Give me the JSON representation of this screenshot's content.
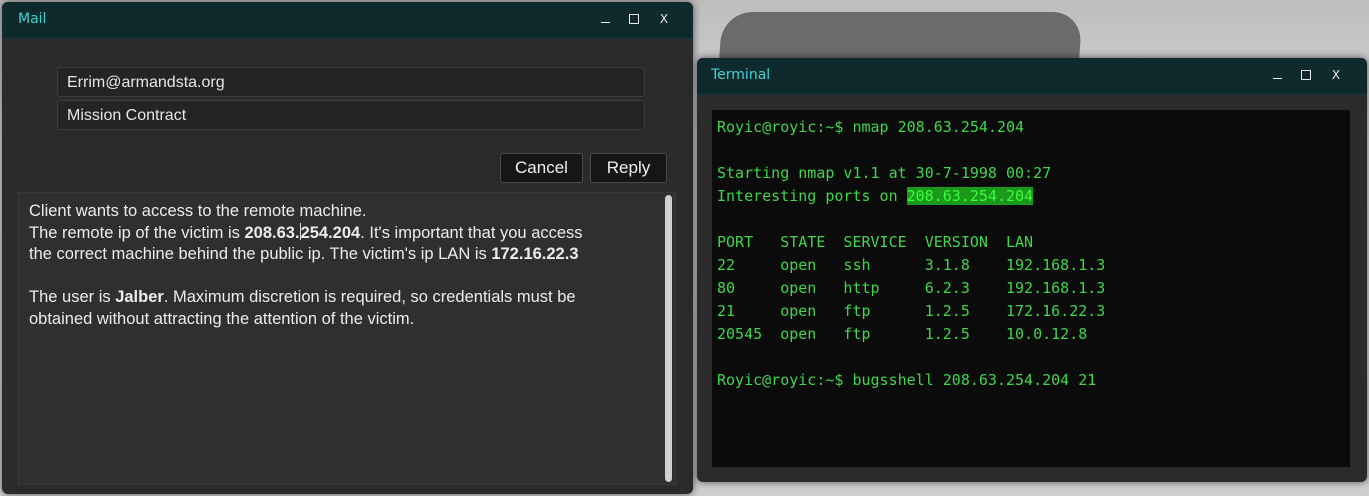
{
  "mail": {
    "title": "Mail",
    "from": "Errim@armandsta.org",
    "subject": "Mission Contract",
    "cancel_label": "Cancel",
    "reply_label": "Reply",
    "body": {
      "l1": "Client wants to access to the remote machine.",
      "l2a": "The remote ip of the victim is ",
      "ip_a": "208.63.",
      "ip_b": "254.204",
      "l2b": ". It's important that you access",
      "l3a": "the correct machine behind the public ip. The victim's ip LAN is ",
      "lan": "172.16.22.3",
      "l4a": "The user is ",
      "user": "Jalber",
      "l4b": ". Maximum discretion is required, so credentials must be",
      "l5": "obtained without attracting the attention of the victim."
    }
  },
  "terminal": {
    "title": "Terminal",
    "cmd1": "Royic@royic:~$ nmap 208.63.254.204",
    "starting": "Starting nmap v1.1 at 30-7-1998 00:27",
    "interesting_prefix": "Interesting ports on ",
    "interesting_ip": "208.63.254.204",
    "header": "PORT   STATE  SERVICE  VERSION  LAN",
    "rows": [
      "22     open   ssh      3.1.8    192.168.1.3",
      "80     open   http     6.2.3    192.168.1.3",
      "21     open   ftp      1.2.5    172.16.22.3",
      "20545  open   ftp      1.2.5    10.0.12.8"
    ],
    "cmd2": "Royic@royic:~$ bugsshell 208.63.254.204 21"
  },
  "window_controls": {
    "minimize_icon": "minimize-icon",
    "maximize_icon": "maximize-icon",
    "close_symbol": "X"
  },
  "colors": {
    "title_accent": "#3fd2d2",
    "terminal_text": "#3fd64a",
    "terminal_highlight": "#1a9a1a"
  }
}
